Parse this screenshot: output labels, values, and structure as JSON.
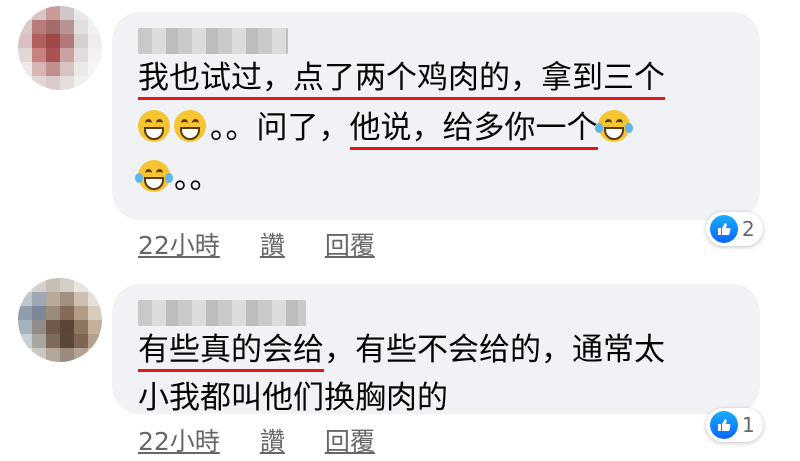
{
  "comments": [
    {
      "avatar_colors": [
        "#e6e2e2",
        "#d9c4c4",
        "#c89a9a",
        "#cfc7c7",
        "#e9e7e7",
        "#f3f3f3",
        "#d7caca",
        "#b77b7b",
        "#a56b6b",
        "#b69494",
        "#e2dede",
        "#f1f1f1",
        "#d8c0c0",
        "#b45f5f",
        "#9f4848",
        "#b17a7a",
        "#d6d0d0",
        "#eeeeee",
        "#e1d7d7",
        "#c98181",
        "#a95454",
        "#c9a1a1",
        "#e2dcdc",
        "#f2f2f2",
        "#efeaea",
        "#d7b5b5",
        "#c28f8f",
        "#d8c3c3",
        "#ebe8e8",
        "#f6f6f6",
        "#f3f3f3",
        "#e3d6d6",
        "#dccaca",
        "#e5dcdc",
        "#f1f0f0",
        "#f8f8f8"
      ],
      "line1_u": "我也试过，点了两个鸡肉的，拿到三个",
      "line2_pre": "。。问了，",
      "line2_u": "他说，给多你一个",
      "line3": "。。",
      "time": "22小時",
      "like": "讚",
      "reply": "回覆",
      "reaction_count": "2"
    },
    {
      "avatar_colors": [
        "#e9e7e6",
        "#d6d0cb",
        "#c7beb5",
        "#d4cec8",
        "#e8e4df",
        "#f3f2f0",
        "#bfc6cf",
        "#9ea8b5",
        "#b7a99a",
        "#a38f7d",
        "#cdbfb2",
        "#e6dfd7",
        "#8f9cab",
        "#7b8698",
        "#9c8b7a",
        "#846b57",
        "#b29c87",
        "#d9cbbd",
        "#a7b2bf",
        "#8f8c8a",
        "#6f5a4a",
        "#5b4537",
        "#8f7460",
        "#c4b09c",
        "#c9cfd6",
        "#a9a5a1",
        "#7e6b5d",
        "#5a463b",
        "#7e6655",
        "#b5a08f",
        "#e1e3e6",
        "#cbc7c3",
        "#b4a89d",
        "#9b8b7f",
        "#b3a395",
        "#d2c6bb"
      ],
      "line1_u": "有些真的会给",
      "line1_rest": "，有些不会给的，通常太",
      "line2": "小我都叫他们换胸肉的",
      "time": "22小時",
      "like": "讚",
      "reply": "回覆",
      "reaction_count": "1"
    }
  ],
  "colors": {
    "bubble": "#f0f2f5",
    "underline": "#e4161b",
    "like_blue": "#0866ff",
    "meta_text": "#65676b"
  }
}
